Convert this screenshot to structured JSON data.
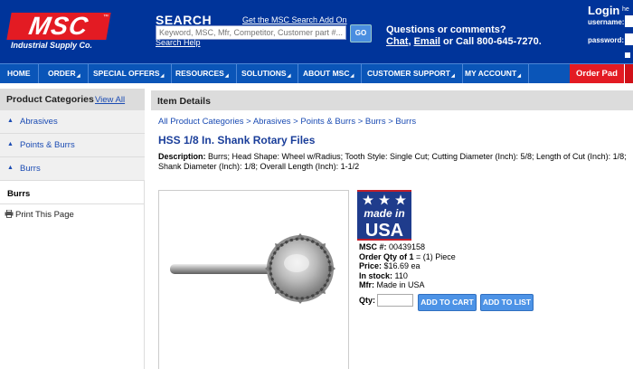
{
  "header": {
    "logo_text": "MSC",
    "logo_tm": "™",
    "logo_subtitle": "Industrial Supply Co.",
    "search": {
      "title": "SEARCH",
      "addon_link": "Get the MSC Search Add On",
      "placeholder": "Keyword, MSC, Mfr, Competitor, Customer part #...",
      "go_label": "GO",
      "help_link": "Search Help"
    },
    "questions": {
      "line1": "Questions or comments?",
      "chat": "Chat",
      "comma": ",",
      "email": "Email",
      "rest": " or Call 800-645-7270."
    },
    "login": {
      "title": "Login",
      "help": "he",
      "username_label": "username:",
      "password_label": "password:"
    }
  },
  "nav": {
    "items": [
      {
        "label": "HOME"
      },
      {
        "label": "ORDER"
      },
      {
        "label": "SPECIAL OFFERS"
      },
      {
        "label": "RESOURCES"
      },
      {
        "label": "SOLUTIONS"
      },
      {
        "label": "ABOUT MSC"
      },
      {
        "label": "CUSTOMER SUPPORT"
      },
      {
        "label": "MY ACCOUNT"
      }
    ],
    "order_pad": "Order Pad"
  },
  "sidebar": {
    "title": "Product Categories",
    "view_all": "View All",
    "categories": [
      {
        "label": "Abrasives"
      },
      {
        "label": "Points & Burrs"
      },
      {
        "label": "Burrs"
      }
    ],
    "current": "Burrs",
    "print": "Print This Page"
  },
  "main": {
    "section_title": "Item Details",
    "breadcrumb": "All Product Categories > Abrasives > Points & Burrs > Burrs > Burrs",
    "product_title": "HSS 1/8 In. Shank Rotary Files",
    "description_label": "Description:",
    "description_text": " Burrs; Head Shape: Wheel w/Radius; Tooth Style: Single Cut; Cutting Diameter (Inch): 5/8; Length of Cut (Inch): 1/8; Shank Diameter (Inch): 1/8; Overall Length (Inch): 1-1/2",
    "badge_text_top": "made in",
    "badge_text_bottom": "USA",
    "details": {
      "msc_label": "MSC #:",
      "msc_value": " 00439158",
      "order_qty_label": "Order Qty of 1",
      "order_qty_value": " = (1) Piece",
      "price_label": "Price:",
      "price_value": " $16.69 ea",
      "stock_label": "In stock:",
      "stock_value": " 110",
      "mfr_label": "Mfr:",
      "mfr_value": " Made in USA"
    },
    "qty_label": "Qty:",
    "add_to_cart": "ADD TO CART",
    "add_to_list": "ADD TO LIST"
  }
}
